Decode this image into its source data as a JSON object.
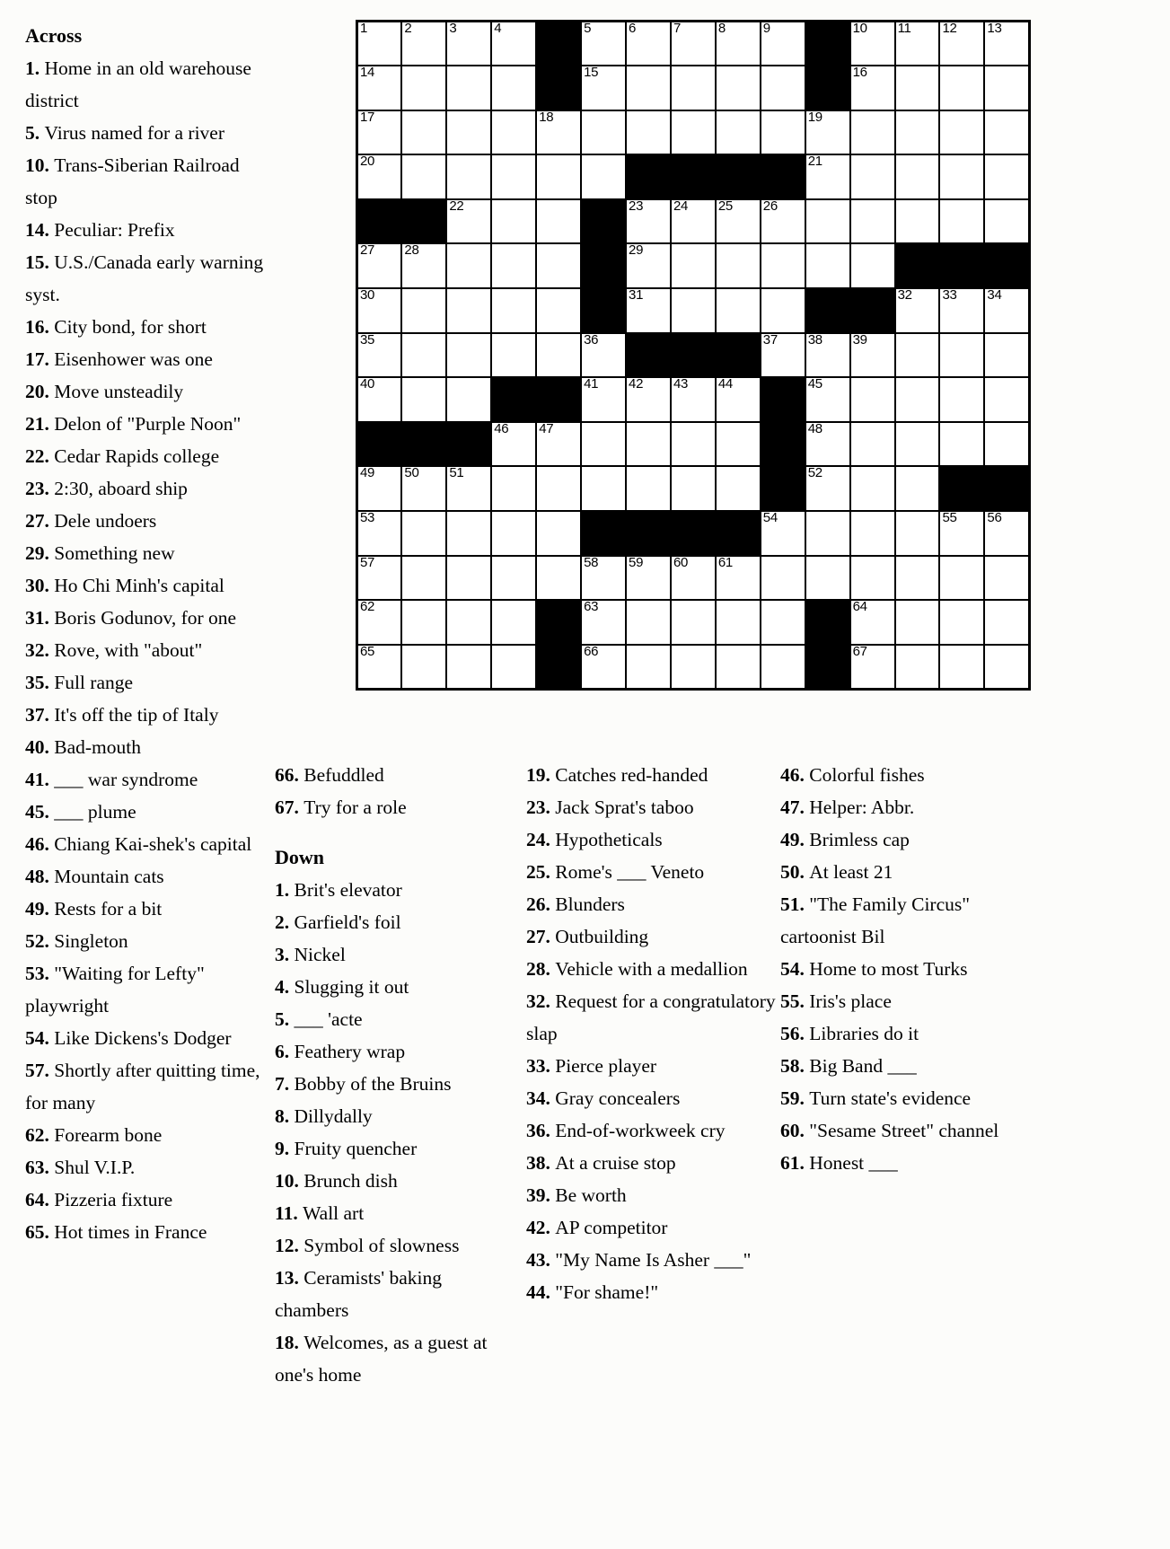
{
  "headings": {
    "across": "Across",
    "down": "Down"
  },
  "across_clues": [
    {
      "n": "1.",
      "text": "Home in an old warehouse district"
    },
    {
      "n": "5.",
      "text": "Virus named for a river"
    },
    {
      "n": "10.",
      "text": "Trans-Siberian Railroad stop"
    },
    {
      "n": "14.",
      "text": "Peculiar: Prefix"
    },
    {
      "n": "15.",
      "text": "U.S./Canada early warning syst."
    },
    {
      "n": "16.",
      "text": "City bond, for short"
    },
    {
      "n": "17.",
      "text": "Eisenhower was one"
    },
    {
      "n": "20.",
      "text": "Move unsteadily"
    },
    {
      "n": "21.",
      "text": "Delon of \"Purple Noon\""
    },
    {
      "n": "22.",
      "text": "Cedar Rapids college"
    },
    {
      "n": "23.",
      "text": "2:30, aboard ship"
    },
    {
      "n": "27.",
      "text": "Dele undoers"
    },
    {
      "n": "29.",
      "text": "Something new"
    },
    {
      "n": "30.",
      "text": "Ho Chi Minh's capital"
    },
    {
      "n": "31.",
      "text": "Boris Godunov, for one"
    },
    {
      "n": "32.",
      "text": "Rove, with \"about\""
    },
    {
      "n": "35.",
      "text": "Full range"
    },
    {
      "n": "37.",
      "text": "It's off the tip of Italy"
    },
    {
      "n": "40.",
      "text": "Bad-mouth"
    },
    {
      "n": "41.",
      "text": "___ war syndrome"
    },
    {
      "n": "45.",
      "text": "___ plume"
    },
    {
      "n": "46.",
      "text": "Chiang Kai-shek's capital"
    },
    {
      "n": "48.",
      "text": "Mountain cats"
    },
    {
      "n": "49.",
      "text": "Rests for a bit"
    },
    {
      "n": "52.",
      "text": "Singleton"
    },
    {
      "n": "53.",
      "text": "\"Waiting for Lefty\" playwright"
    },
    {
      "n": "54.",
      "text": "Like Dickens's Dodger"
    },
    {
      "n": "57.",
      "text": "Shortly after quitting time, for many"
    },
    {
      "n": "62.",
      "text": "Forearm bone"
    },
    {
      "n": "63.",
      "text": "Shul V.I.P."
    },
    {
      "n": "64.",
      "text": "Pizzeria fixture"
    },
    {
      "n": "65.",
      "text": "Hot times in France"
    },
    {
      "n": "66.",
      "text": "Befuddled"
    },
    {
      "n": "67.",
      "text": "Try for a role"
    }
  ],
  "down_clues": [
    {
      "n": "1.",
      "text": "Brit's elevator"
    },
    {
      "n": "2.",
      "text": "Garfield's foil"
    },
    {
      "n": "3.",
      "text": "Nickel"
    },
    {
      "n": "4.",
      "text": "Slugging it out"
    },
    {
      "n": "5.",
      "text": "___ 'acte"
    },
    {
      "n": "6.",
      "text": "Feathery wrap"
    },
    {
      "n": "7.",
      "text": "Bobby of the Bruins"
    },
    {
      "n": "8.",
      "text": "Dillydally"
    },
    {
      "n": "9.",
      "text": "Fruity quencher"
    },
    {
      "n": "10.",
      "text": "Brunch dish"
    },
    {
      "n": "11.",
      "text": "Wall art"
    },
    {
      "n": "12.",
      "text": "Symbol of slowness"
    },
    {
      "n": "13.",
      "text": "Ceramists' baking chambers"
    },
    {
      "n": "18.",
      "text": "Welcomes, as a guest at one's home"
    },
    {
      "n": "19.",
      "text": "Catches red-handed"
    },
    {
      "n": "23.",
      "text": "Jack Sprat's taboo"
    },
    {
      "n": "24.",
      "text": "Hypotheticals"
    },
    {
      "n": "25.",
      "text": "Rome's ___ Veneto"
    },
    {
      "n": "26.",
      "text": "Blunders"
    },
    {
      "n": "27.",
      "text": "Outbuilding"
    },
    {
      "n": "28.",
      "text": "Vehicle with a medallion"
    },
    {
      "n": "32.",
      "text": "Request for a congratulatory slap"
    },
    {
      "n": "33.",
      "text": "Pierce player"
    },
    {
      "n": "34.",
      "text": "Gray concealers"
    },
    {
      "n": "36.",
      "text": "End-of-workweek cry"
    },
    {
      "n": "38.",
      "text": "At a cruise stop"
    },
    {
      "n": "39.",
      "text": "Be worth"
    },
    {
      "n": "42.",
      "text": "AP competitor"
    },
    {
      "n": "43.",
      "text": "\"My Name Is Asher ___\""
    },
    {
      "n": "44.",
      "text": "\"For shame!\""
    },
    {
      "n": "46.",
      "text": "Colorful fishes"
    },
    {
      "n": "47.",
      "text": "Helper: Abbr."
    },
    {
      "n": "49.",
      "text": "Brimless cap"
    },
    {
      "n": "50.",
      "text": "At least 21"
    },
    {
      "n": "51.",
      "text": "\"The Family Circus\" cartoonist Bil"
    },
    {
      "n": "54.",
      "text": "Home to most Turks"
    },
    {
      "n": "55.",
      "text": "Iris's place"
    },
    {
      "n": "56.",
      "text": "Libraries do it"
    },
    {
      "n": "58.",
      "text": "Big Band ___"
    },
    {
      "n": "59.",
      "text": "Turn state's evidence"
    },
    {
      "n": "60.",
      "text": "\"Sesame Street\" channel"
    },
    {
      "n": "61.",
      "text": "Honest ___"
    }
  ],
  "grid": {
    "rows": 15,
    "cols": 15,
    "cells": [
      [
        {
          "n": "1"
        },
        {
          "n": "2"
        },
        {
          "n": "3"
        },
        {
          "n": "4"
        },
        {
          "b": 1
        },
        {
          "n": "5"
        },
        {
          "n": "6"
        },
        {
          "n": "7"
        },
        {
          "n": "8"
        },
        {
          "n": "9"
        },
        {
          "b": 1
        },
        {
          "n": "10"
        },
        {
          "n": "11"
        },
        {
          "n": "12"
        },
        {
          "n": "13"
        }
      ],
      [
        {
          "n": "14"
        },
        {},
        {},
        {},
        {
          "b": 1
        },
        {
          "n": "15"
        },
        {},
        {},
        {},
        {},
        {
          "b": 1
        },
        {
          "n": "16"
        },
        {},
        {},
        {}
      ],
      [
        {
          "n": "17"
        },
        {},
        {},
        {},
        {
          "n": "18"
        },
        {},
        {},
        {},
        {},
        {},
        {
          "n": "19"
        },
        {},
        {},
        {},
        {}
      ],
      [
        {
          "n": "20"
        },
        {},
        {},
        {},
        {},
        {},
        {
          "b": 1
        },
        {
          "b": 1
        },
        {
          "b": 1
        },
        {
          "b": 1
        },
        {
          "n": "21"
        },
        {},
        {},
        {},
        {}
      ],
      [
        {
          "b": 1
        },
        {
          "b": 1
        },
        {
          "n": "22"
        },
        {},
        {},
        {
          "b": 1
        },
        {
          "n": "23"
        },
        {
          "n": "24"
        },
        {
          "n": "25"
        },
        {
          "n": "26"
        },
        {},
        {},
        {},
        {},
        {}
      ],
      [
        {
          "n": "27"
        },
        {
          "n": "28"
        },
        {},
        {},
        {},
        {
          "b": 1
        },
        {
          "n": "29"
        },
        {},
        {},
        {},
        {},
        {},
        {
          "b": 1
        },
        {
          "b": 1
        },
        {
          "b": 1
        }
      ],
      [
        {
          "n": "30"
        },
        {},
        {},
        {},
        {},
        {
          "b": 1
        },
        {
          "n": "31"
        },
        {},
        {},
        {},
        {
          "b": 1
        },
        {
          "b": 1
        },
        {
          "n": "32"
        },
        {
          "n": "33"
        },
        {
          "n": "34"
        }
      ],
      [
        {
          "n": "35"
        },
        {},
        {},
        {},
        {},
        {
          "n": "36"
        },
        {
          "b": 1
        },
        {
          "b": 1
        },
        {
          "b": 1
        },
        {
          "n": "37"
        },
        {
          "n": "38"
        },
        {
          "n": "39"
        },
        {},
        {},
        {}
      ],
      [
        {
          "n": "40"
        },
        {},
        {},
        {
          "b": 1
        },
        {
          "b": 1
        },
        {
          "n": "41"
        },
        {
          "n": "42"
        },
        {
          "n": "43"
        },
        {
          "n": "44"
        },
        {
          "b": 1
        },
        {
          "n": "45"
        },
        {},
        {},
        {},
        {}
      ],
      [
        {
          "b": 1
        },
        {
          "b": 1
        },
        {
          "b": 1
        },
        {
          "n": "46"
        },
        {
          "n": "47"
        },
        {},
        {},
        {},
        {},
        {
          "b": 1
        },
        {
          "n": "48"
        },
        {},
        {},
        {},
        {}
      ],
      [
        {
          "n": "49"
        },
        {
          "n": "50"
        },
        {
          "n": "51"
        },
        {},
        {},
        {},
        {},
        {},
        {},
        {
          "b": 1
        },
        {
          "n": "52"
        },
        {},
        {},
        {
          "b": 1
        },
        {
          "b": 1
        }
      ],
      [
        {
          "n": "53"
        },
        {},
        {},
        {},
        {},
        {
          "b": 1
        },
        {
          "b": 1
        },
        {
          "b": 1
        },
        {
          "b": 1
        },
        {
          "n": "54"
        },
        {},
        {},
        {},
        {
          "n": "55"
        },
        {
          "n": "56"
        }
      ],
      [
        {
          "n": "57"
        },
        {},
        {},
        {},
        {},
        {
          "n": "58"
        },
        {
          "n": "59"
        },
        {
          "n": "60"
        },
        {
          "n": "61"
        },
        {},
        {},
        {},
        {},
        {},
        {}
      ],
      [
        {
          "n": "62"
        },
        {},
        {},
        {},
        {
          "b": 1
        },
        {
          "n": "63"
        },
        {},
        {},
        {},
        {},
        {
          "b": 1
        },
        {
          "n": "64"
        },
        {},
        {},
        {}
      ],
      [
        {
          "n": "65"
        },
        {},
        {},
        {},
        {
          "b": 1
        },
        {
          "n": "66"
        },
        {},
        {},
        {},
        {},
        {
          "b": 1
        },
        {
          "n": "67"
        },
        {},
        {},
        {}
      ]
    ]
  },
  "column_split": {
    "across_col1_count": 32,
    "col2_across_tail": [
      "66.",
      "67."
    ],
    "col2_down_start": 0,
    "col2_down_end": 14,
    "col3_down_start": 14,
    "col3_down_end": 30,
    "col4_down_start": 30
  },
  "colors": {
    "page_bg": "#fcfcfa",
    "ink": "#000000",
    "cell_fill": "#ffffff",
    "block_fill": "#000000"
  }
}
